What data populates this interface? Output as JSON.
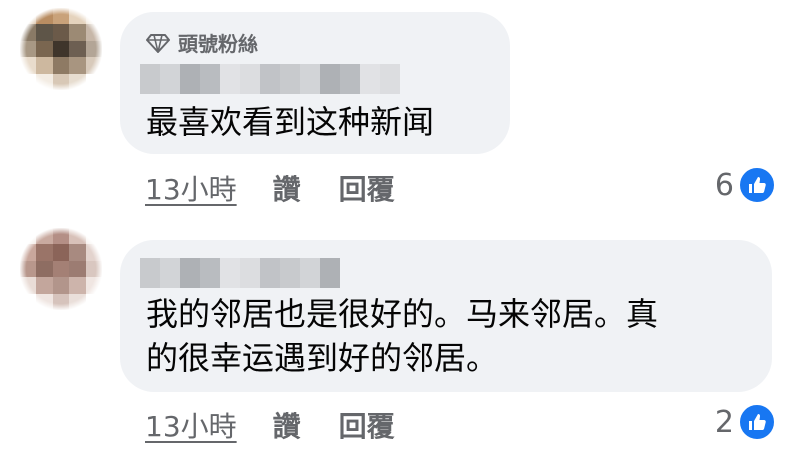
{
  "colors": {
    "bubble_bg": "#f0f2f5",
    "accent": "#1877f2",
    "secondary_text": "#65676b"
  },
  "comments": [
    {
      "badge_icon": "diamond-icon",
      "badge_label": "頭號粉絲",
      "text": "最喜欢看到这种新闻",
      "time": "13小時",
      "like_label": "讚",
      "reply_label": "回覆",
      "reaction_count": "6",
      "reaction_icon": "thumbs-up-icon"
    },
    {
      "text": "我的邻居也是很好的。马来邻居。真\n的很幸运遇到好的邻居。",
      "time": "13小時",
      "like_label": "讚",
      "reply_label": "回覆",
      "reaction_count": "2",
      "reaction_icon": "thumbs-up-icon"
    }
  ]
}
